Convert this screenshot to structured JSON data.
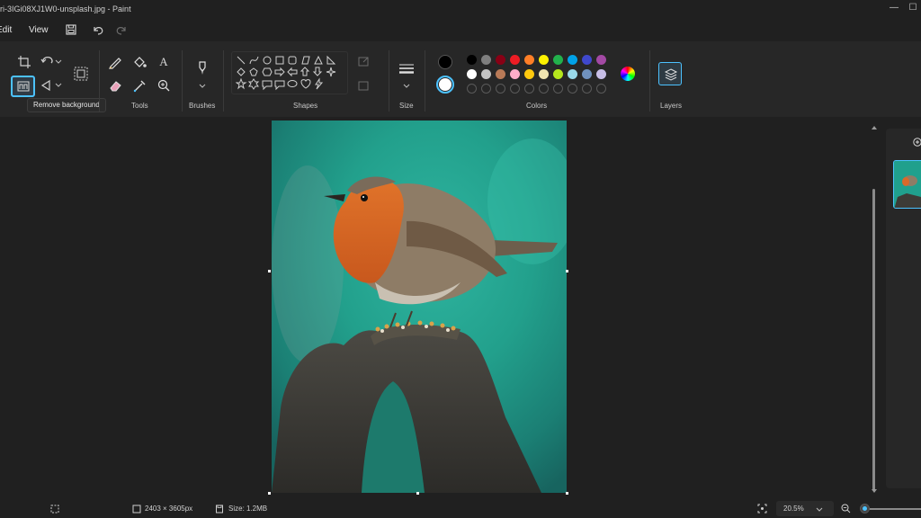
{
  "title": "ri-3IGi08XJ1W0-unsplash.jpg - Paint",
  "window": {
    "minimize_icon": "minimize-icon",
    "close_icon": "close-icon"
  },
  "menu": {
    "edit": "Edit",
    "view": "View"
  },
  "ribbon": {
    "groups": {
      "tools": "Tools",
      "brushes": "Brushes",
      "shapes": "Shapes",
      "size": "Size",
      "colors": "Colors",
      "layers": "Layers"
    },
    "tooltip": "Remove background"
  },
  "colors": {
    "primary": "#000000",
    "secondary": "#ffffff",
    "row1": [
      "#000000",
      "#7f7f7f",
      "#880015",
      "#ed1c24",
      "#ff7f27",
      "#fff200",
      "#22b14c",
      "#00a2e8",
      "#3f48cc",
      "#a349a4"
    ],
    "row2": [
      "#ffffff",
      "#c3c3c3",
      "#b97a57",
      "#ffaec9",
      "#ffc90e",
      "#efe4b0",
      "#b5e61d",
      "#99d9ea",
      "#7092be",
      "#c8bfe7"
    ],
    "row3_empty_count": 10,
    "accent": "#4cc2ff"
  },
  "status": {
    "dimensions": "2403 × 3605px",
    "size": "Size: 1.2MB",
    "zoom": "20.5%"
  }
}
